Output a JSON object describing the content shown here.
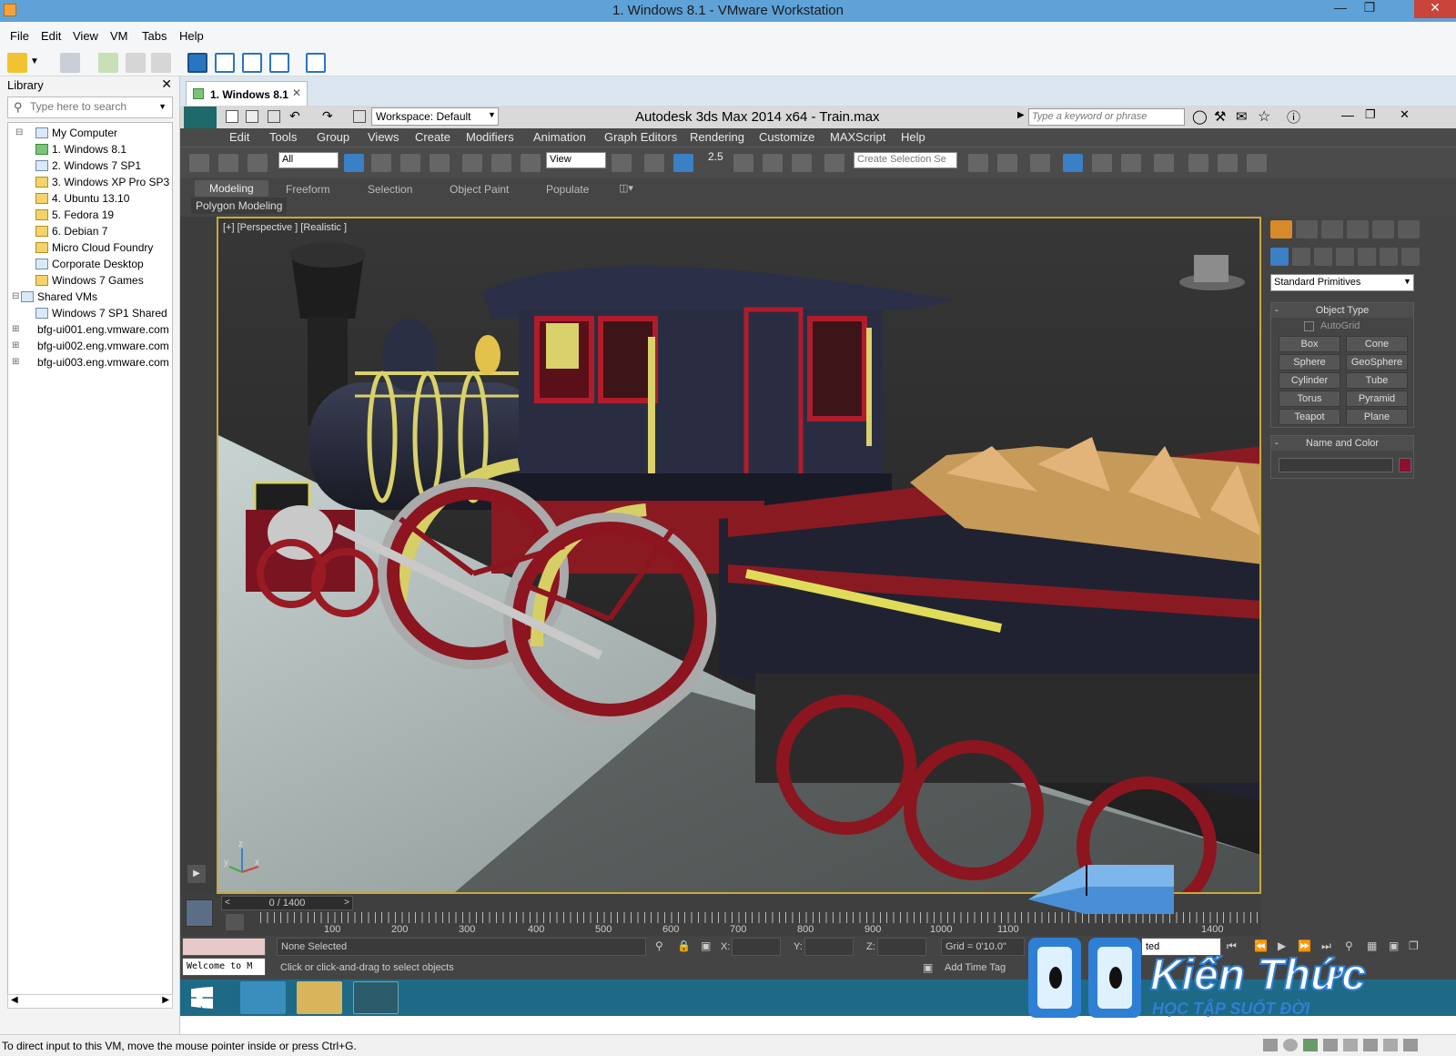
{
  "window": {
    "title": "1. Windows 8.1 - VMware Workstation"
  },
  "vmware_menu": [
    "File",
    "Edit",
    "View",
    "VM",
    "Tabs",
    "Help"
  ],
  "library": {
    "title": "Library",
    "search_placeholder": "Type here to search",
    "tree": [
      {
        "label": "My Computer",
        "level": 0
      },
      {
        "label": "1. Windows 8.1",
        "level": 1
      },
      {
        "label": "2. Windows 7 SP1",
        "level": 1
      },
      {
        "label": "3. Windows XP Pro SP3",
        "level": 1
      },
      {
        "label": "4. Ubuntu 13.10",
        "level": 1
      },
      {
        "label": "5. Fedora 19",
        "level": 1
      },
      {
        "label": "6. Debian 7",
        "level": 1
      },
      {
        "label": "Micro Cloud Foundry",
        "level": 1
      },
      {
        "label": "Corporate Desktop",
        "level": 1
      },
      {
        "label": "Windows 7 Games",
        "level": 1
      },
      {
        "label": "Shared VMs",
        "level": 0
      },
      {
        "label": "Windows 7 SP1 Shared",
        "level": 1
      },
      {
        "label": "bfg-ui001.eng.vmware.com",
        "level": 0
      },
      {
        "label": "bfg-ui002.eng.vmware.com",
        "level": 0
      },
      {
        "label": "bfg-ui003.eng.vmware.com",
        "level": 0
      }
    ]
  },
  "vm_tab": {
    "label": "1. Windows 8.1"
  },
  "max": {
    "title": "Autodesk 3ds Max  2014 x64   - Train.max",
    "workspace": "Workspace: Default",
    "keyword_placeholder": "Type a keyword or phrase",
    "menu": [
      "Edit",
      "Tools",
      "Group",
      "Views",
      "Create",
      "Modifiers",
      "Animation",
      "Graph Editors",
      "Rendering",
      "Customize",
      "MAXScript",
      "Help"
    ],
    "selection_filter": "All",
    "ref_coord": "View",
    "snap_value": "2.5",
    "selection_set": "Create Selection Se",
    "ribbon_tabs": [
      "Modeling",
      "Freeform",
      "Selection",
      "Object Paint",
      "Populate"
    ],
    "ribbon_panel": "Polygon Modeling",
    "viewport_label": "[+] [Perspective ] [Realistic ]",
    "axis_labels": {
      "z": "z",
      "y": "y",
      "x": "x"
    },
    "command_panel": {
      "dropdown": "Standard Primitives",
      "object_type_title": "Object Type",
      "autogrid": "AutoGrid",
      "buttons": [
        "Box",
        "Cone",
        "Sphere",
        "GeoSphere",
        "Cylinder",
        "Tube",
        "Torus",
        "Pyramid",
        "Teapot",
        "Plane"
      ],
      "name_color_title": "Name and Color",
      "object_color": "#8a1030"
    },
    "timeline": {
      "frame": "0 / 1400",
      "ticks": [
        "100",
        "200",
        "300",
        "400",
        "500",
        "600",
        "700",
        "800",
        "900",
        "1000",
        "1100",
        "1400"
      ]
    },
    "status": {
      "selection": "None Selected",
      "prompt": "Click or click-and-drag to select objects",
      "x_label": "X:",
      "y_label": "Y:",
      "z_label": "Z:",
      "grid": "Grid = 0'10.0\"",
      "add_time_tag": "Add Time Tag",
      "listener": "Welcome to M",
      "key_dropdown": "ted"
    }
  },
  "watermark": {
    "brand": "Kiến Thức",
    "tagline": "HỌC TẬP SUỐT ĐỜI"
  },
  "status_bar": {
    "text": "To direct input to this VM, move the mouse pointer inside or press Ctrl+G."
  },
  "colors": {
    "accent": "#5ea2d8",
    "viewport_border": "#c9a83c",
    "taskbar": "#1e6a86"
  }
}
